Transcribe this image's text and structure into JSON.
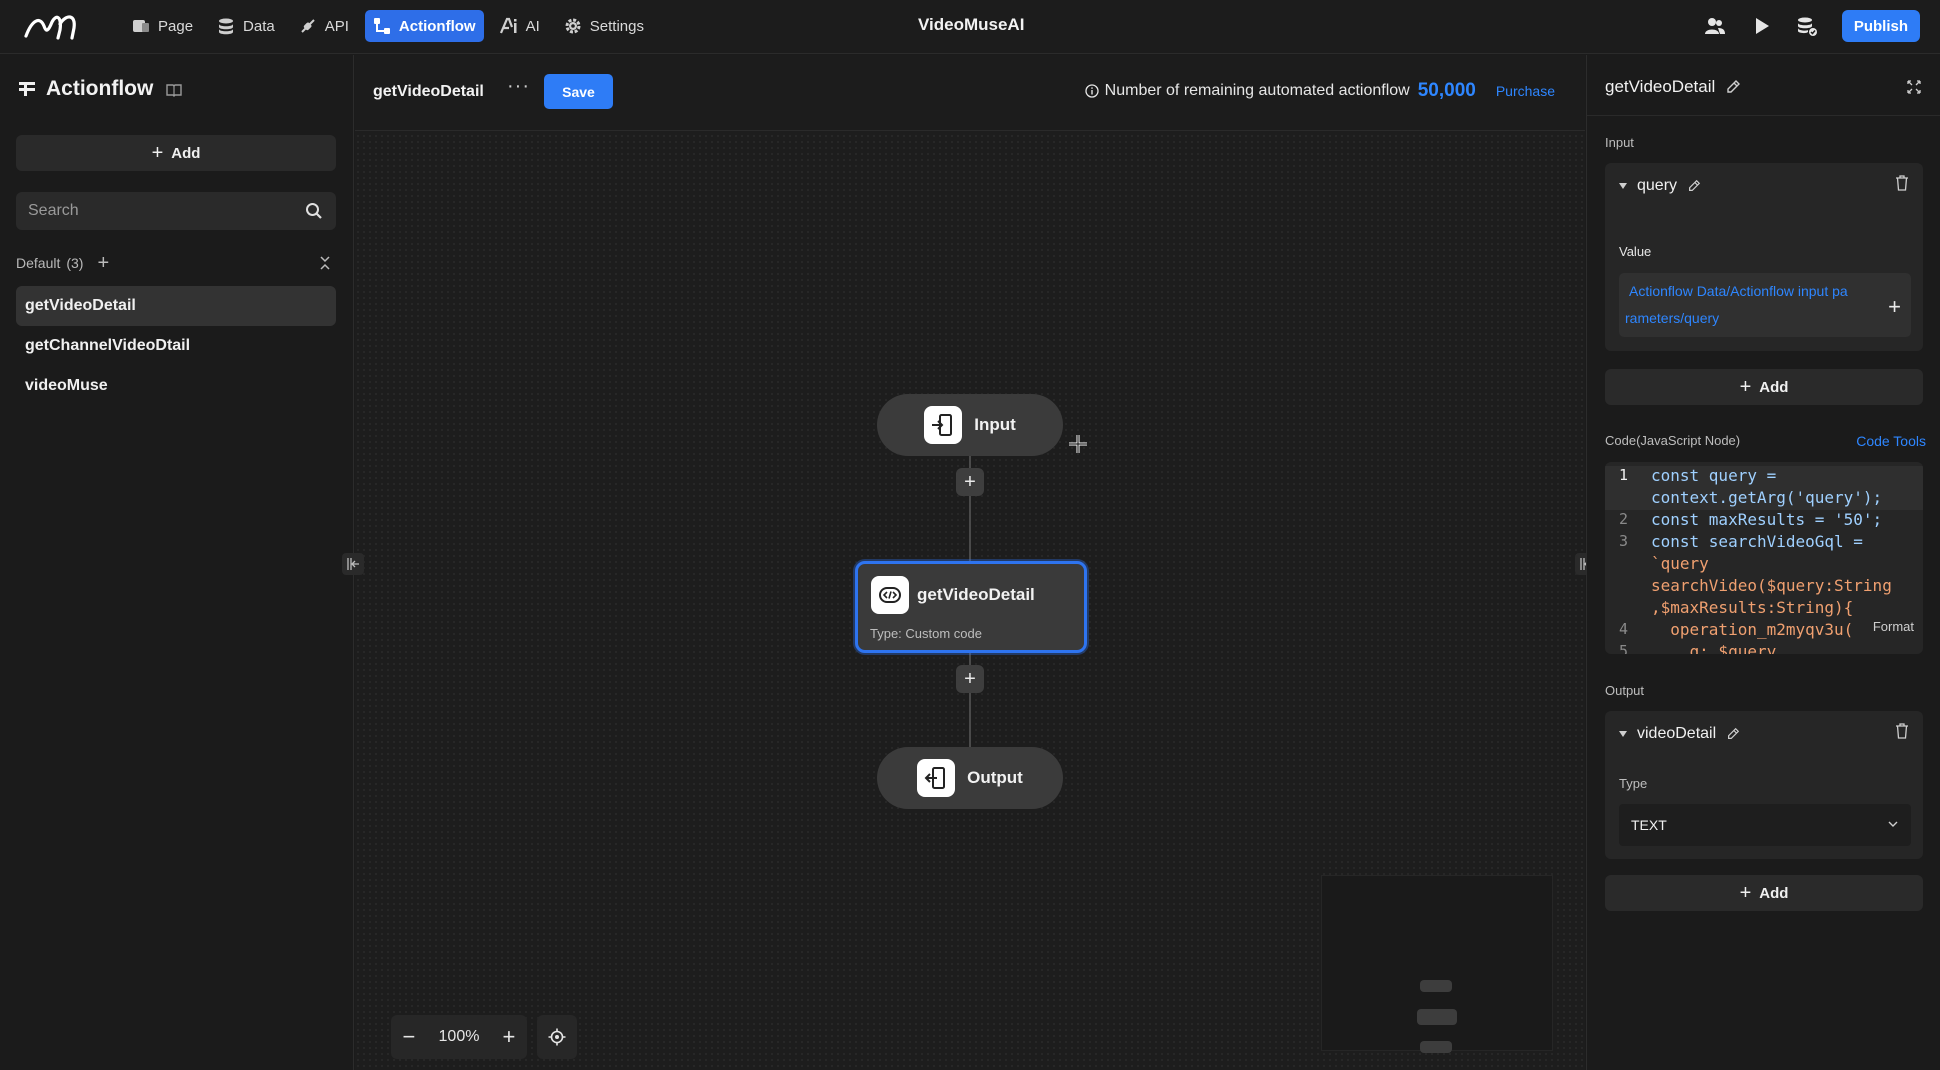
{
  "topbar": {
    "nav": [
      {
        "label": "Page",
        "icon": "page-icon"
      },
      {
        "label": "Data",
        "icon": "database-icon"
      },
      {
        "label": "API",
        "icon": "api-icon"
      },
      {
        "label": "Actionflow",
        "icon": "actionflow-icon",
        "active": true
      },
      {
        "label": "AI",
        "icon": "ai-icon"
      },
      {
        "label": "Settings",
        "icon": "gear-icon"
      }
    ],
    "app_title": "VideoMuseAI",
    "publish_label": "Publish"
  },
  "sidebar": {
    "title": "Actionflow",
    "add_label": "Add",
    "search_placeholder": "Search",
    "group_name": "Default",
    "group_count": "(3)",
    "items": [
      {
        "label": "getVideoDetail",
        "selected": true
      },
      {
        "label": "getChannelVideoDtail"
      },
      {
        "label": "videoMuse"
      }
    ]
  },
  "canvas": {
    "flow_name": "getVideoDetail",
    "more": "···",
    "save_label": "Save",
    "remaining_text": "Number of remaining automated actionflow",
    "remaining_count": "50,000",
    "purchase_label": "Purchase",
    "nodes": {
      "input_label": "Input",
      "main_label": "getVideoDetail",
      "main_type": "Type:  Custom code",
      "output_label": "Output"
    },
    "zoom": {
      "minus": "−",
      "level": "100%",
      "plus": "+"
    }
  },
  "panel": {
    "title": "getVideoDetail",
    "input_label": "Input",
    "input_param": "query",
    "value_label": "Value",
    "value_line1": "Actionflow Data/Actionflow input pa",
    "value_line2": "rameters/query",
    "add_label": "Add",
    "code_label": "Code(JavaScript Node)",
    "code_tools": "Code Tools",
    "format_label": "Format",
    "code_lines": [
      {
        "n": "1",
        "text": "const query ="
      },
      {
        "n": "",
        "text": "context.getArg('query');"
      },
      {
        "n": "2",
        "text": "const maxResults = '50';"
      },
      {
        "n": "3",
        "text": "const searchVideoGql ="
      },
      {
        "n": "",
        "text": "`query"
      },
      {
        "n": "",
        "text": "searchVideo($query:String"
      },
      {
        "n": "",
        "text": ",$maxResults:String){"
      },
      {
        "n": "4",
        "text": "  operation_m2myqv3u("
      },
      {
        "n": "5",
        "text": "    q: $query"
      }
    ],
    "output_label": "Output",
    "output_param": "videoDetail",
    "type_label": "Type",
    "type_value": "TEXT",
    "add_label2": "Add"
  },
  "colors": {
    "accent": "#2e7cf6",
    "link": "#2e86ff",
    "bg": "#1b1b1b"
  }
}
